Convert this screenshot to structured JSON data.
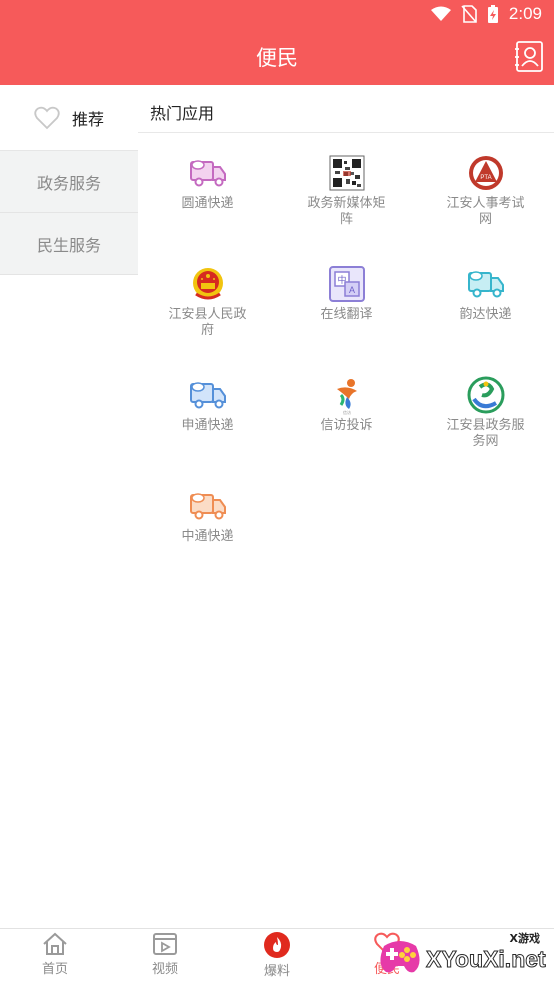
{
  "status_bar": {
    "time": "2:09"
  },
  "header": {
    "title": "便民",
    "contact_icon": "contact-book-icon"
  },
  "sidebar": {
    "items": [
      {
        "label": "推荐",
        "icon": "heart-outline-icon",
        "active": true
      },
      {
        "label": "政务服务",
        "active": false
      },
      {
        "label": "民生服务",
        "active": false
      }
    ]
  },
  "main": {
    "section_title": "热门应用",
    "apps": [
      {
        "label": "圆通快递",
        "icon": "truck-purple-icon"
      },
      {
        "label": "政务新媒体矩阵",
        "icon": "qr-code-icon"
      },
      {
        "label": "江安人事考试网",
        "icon": "pta-emblem-icon"
      },
      {
        "label": "江安县人民政府",
        "icon": "national-emblem-icon"
      },
      {
        "label": "在线翻译",
        "icon": "translate-icon"
      },
      {
        "label": "韵达快递",
        "icon": "truck-teal-icon"
      },
      {
        "label": "申通快递",
        "icon": "truck-blue-icon"
      },
      {
        "label": "信访投诉",
        "icon": "petition-figure-icon"
      },
      {
        "label": "江安县政务服务网",
        "icon": "gov-service-logo-icon"
      },
      {
        "label": "中通快递",
        "icon": "truck-orange-icon"
      }
    ]
  },
  "bottom_nav": {
    "items": [
      {
        "label": "首页",
        "icon": "home-icon"
      },
      {
        "label": "视频",
        "icon": "video-icon"
      },
      {
        "label": "爆料",
        "icon": "fire-icon"
      },
      {
        "label": "便民",
        "icon": "heart-icon",
        "active": true
      }
    ]
  },
  "watermark": {
    "brand": "XYouXi.net",
    "small": "X游戏"
  },
  "colors": {
    "brand_red": "#f65a5a",
    "text_gray": "#8a8a8a",
    "sidebar_bg": "#f2f3f3"
  }
}
